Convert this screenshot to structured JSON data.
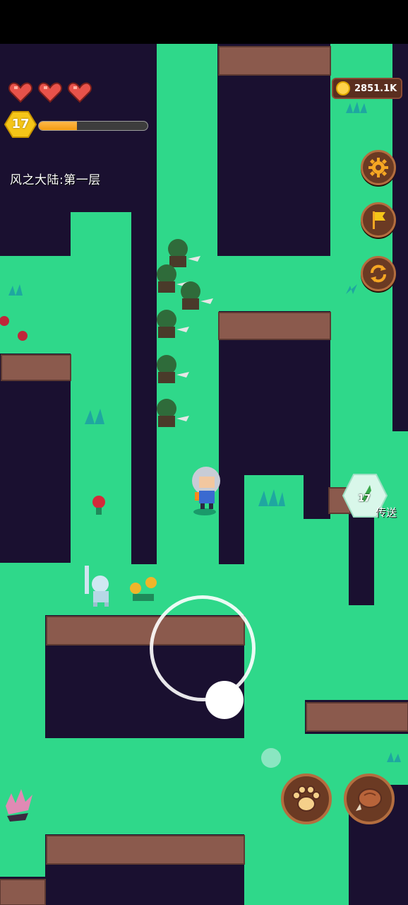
{
  "player": {
    "hearts": 3,
    "level": "17",
    "xp_fraction": 0.35
  },
  "region": {
    "name": "风之大陆:第一层"
  },
  "currency": {
    "gold": "2851.1K",
    "icon": "coin-icon"
  },
  "buttons": {
    "settings": "gear-icon",
    "flag": "flag-icon",
    "refresh": "refresh-icon",
    "paw": "paw-icon",
    "skill": "meat-icon"
  },
  "teleport": {
    "level": "17",
    "label": "传送"
  },
  "colors": {
    "grass": "#2fd88a",
    "pit": "#1a1030",
    "cliff": "#8b5a4d",
    "ui_brown": "#6b3a23",
    "xp": "#f39c12"
  }
}
